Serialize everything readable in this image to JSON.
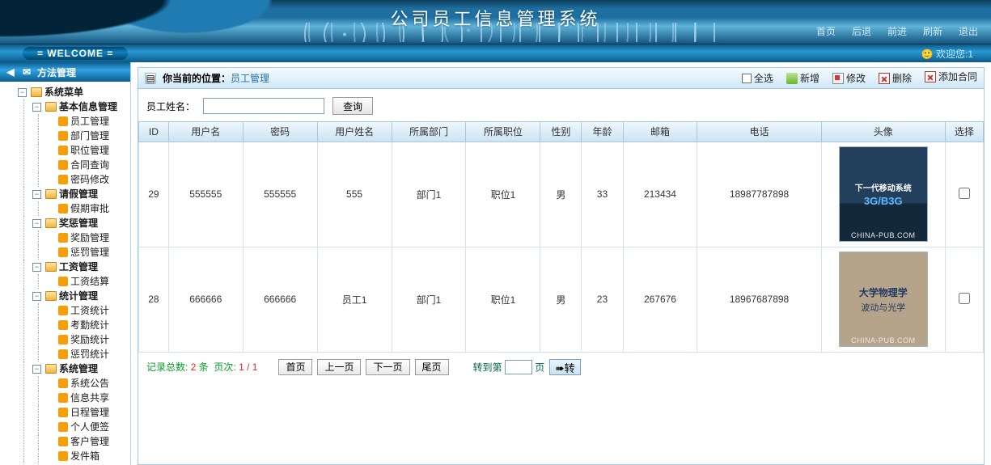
{
  "header": {
    "title": "公司员工信息管理系统",
    "nav": {
      "home": "首页",
      "back": "后退",
      "forward": "前进",
      "refresh": "刷新",
      "logout": "退出"
    }
  },
  "welcome": {
    "badge": "=  WELCOME  =",
    "greeting_prefix": "欢迎您:",
    "user": "1"
  },
  "sidebar": {
    "header": "方法管理",
    "root": "系统菜单",
    "groups": [
      {
        "label": "基本信息管理",
        "open": true,
        "items": [
          "员工管理",
          "部门管理",
          "职位管理",
          "合同查询",
          "密码修改"
        ]
      },
      {
        "label": "请假管理",
        "open": true,
        "items": [
          "假期审批"
        ]
      },
      {
        "label": "奖惩管理",
        "open": true,
        "items": [
          "奖励管理",
          "惩罚管理"
        ]
      },
      {
        "label": "工资管理",
        "open": true,
        "items": [
          "工资结算"
        ]
      },
      {
        "label": "统计管理",
        "open": true,
        "items": [
          "工资统计",
          "考勤统计",
          "奖励统计",
          "惩罚统计"
        ]
      },
      {
        "label": "系统管理",
        "open": true,
        "items": [
          "系统公告",
          "信息共享",
          "日程管理",
          "个人便签",
          "客户管理",
          "发件箱"
        ]
      }
    ]
  },
  "breadcrumb": {
    "prefix": "你当前的位置：",
    "current": "员工管理"
  },
  "toolbar": {
    "select_all": "全选",
    "new": "新增",
    "edit": "修改",
    "delete": "删除",
    "add_contract": "添加合同"
  },
  "search": {
    "label": "员工姓名：",
    "value": "",
    "button": "查询"
  },
  "table": {
    "columns": [
      "ID",
      "用户名",
      "密码",
      "用户姓名",
      "所属部门",
      "所属职位",
      "性别",
      "年龄",
      "邮箱",
      "电话",
      "头像",
      "选择"
    ],
    "rows": [
      {
        "id": "29",
        "username": "555555",
        "password": "555555",
        "realname": "555",
        "dept": "部门1",
        "post": "职位1",
        "gender": "男",
        "age": "33",
        "email": "213434",
        "phone": "18987787898",
        "avatar": {
          "variant": 1,
          "line1": "下一代移动系统",
          "line2": "3G/B3G",
          "footer": "CHINA-PUB.COM"
        }
      },
      {
        "id": "28",
        "username": "666666",
        "password": "666666",
        "realname": "员工1",
        "dept": "部门1",
        "post": "职位1",
        "gender": "男",
        "age": "23",
        "email": "267676",
        "phone": "18967687898",
        "avatar": {
          "variant": 2,
          "line1": "大学物理学",
          "line2": "波动与光学",
          "footer": "CHINA-PUB.COM"
        }
      }
    ]
  },
  "pager": {
    "total_label": "记录总数:",
    "total": "2",
    "unit": "条",
    "pages_label": "页次:",
    "page_fraction": "1 / 1",
    "first": "首页",
    "prev": "上一页",
    "next": "下一页",
    "last": "尾页",
    "jump_prefix": "转到第",
    "jump_suffix": "页",
    "go": "➠转"
  }
}
